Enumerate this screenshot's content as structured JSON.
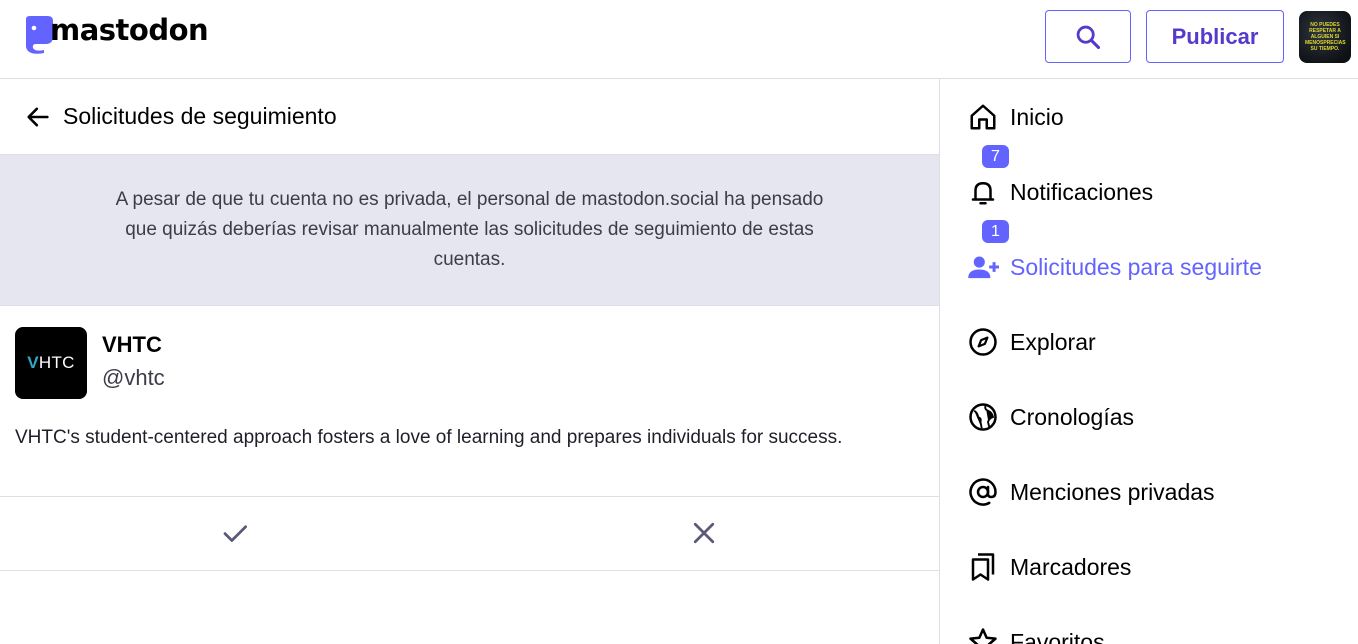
{
  "topbar": {
    "logo_text": "mastodon",
    "publish_label": "Publicar",
    "avatar_text": "NO PUEDES RESPETAR A ALGUIEN SI MENOSPRECIAS SU TIEMPO."
  },
  "column": {
    "title": "Solicitudes de seguimiento",
    "notice": "A pesar de que tu cuenta no es privada, el personal de mastodon.social ha pensado que quizás deberías revisar manualmente las solicitudes de seguimiento de estas cuentas."
  },
  "requests": [
    {
      "avatar_prefix": "V",
      "avatar_rest": "HTC",
      "name": "VHTC",
      "handle": "@vhtc",
      "bio": "VHTC's student-centered approach fosters a love of learning and prepares individuals for success."
    }
  ],
  "sidebar": {
    "items": [
      {
        "label": "Inicio",
        "icon": "home-icon"
      },
      {
        "label": "Notificaciones",
        "icon": "bell-icon",
        "badge": "7"
      },
      {
        "label": "Solicitudes para seguirte",
        "icon": "person-add-icon",
        "badge": "1",
        "active": true
      },
      {
        "label": "Explorar",
        "icon": "compass-icon"
      },
      {
        "label": "Cronologías",
        "icon": "globe-icon"
      },
      {
        "label": "Menciones privadas",
        "icon": "at-icon"
      },
      {
        "label": "Marcadores",
        "icon": "bookmarks-icon"
      },
      {
        "label": "Favoritos",
        "icon": "star-icon"
      }
    ]
  },
  "colors": {
    "accent": "#6364ff",
    "notice_bg": "#e6e6f0",
    "border": "#dedee6"
  }
}
